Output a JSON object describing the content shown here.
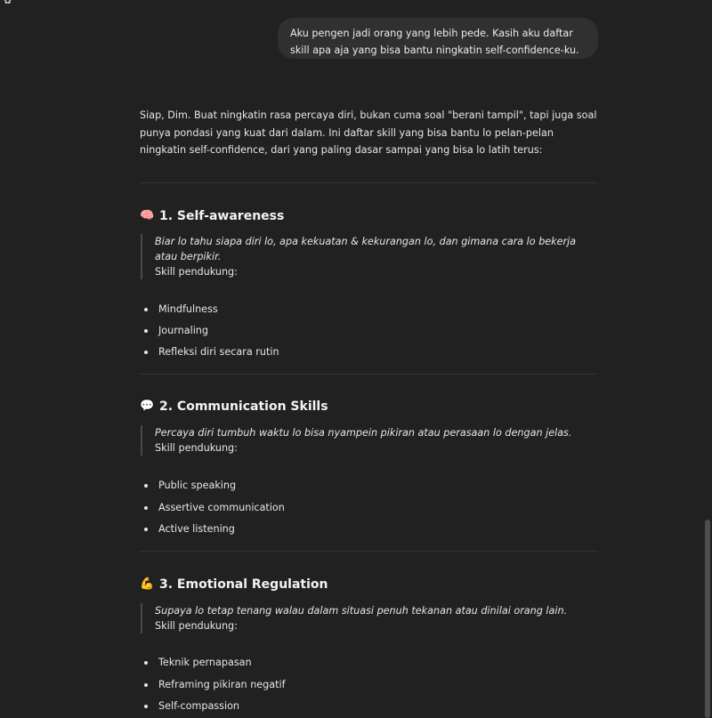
{
  "corner_icon": "openai-logo-icon",
  "user_message": "Aku pengen jadi orang yang lebih pede. Kasih aku daftar skill apa aja yang bisa bantu ningkatin self-confidence-ku.",
  "assistant": {
    "intro": "Siap, Dim. Buat ningkatin rasa percaya diri, bukan cuma soal \"berani tampil\", tapi juga soal punya pondasi yang kuat dari dalam. Ini daftar skill yang bisa bantu lo pelan-pelan ningkatin self-confidence, dari yang paling dasar sampai yang bisa lo latih terus:",
    "sections": [
      {
        "emoji": "🧠",
        "emoji_name": "brain-icon",
        "title": "1. Self-awareness",
        "desc": "Biar lo tahu siapa diri lo, apa kekuatan & kekurangan lo, dan gimana cara lo bekerja atau berpikir.",
        "support_label": "Skill pendukung:",
        "items": [
          "Mindfulness",
          "Journaling",
          "Refleksi diri secara rutin"
        ]
      },
      {
        "emoji": "💬",
        "emoji_name": "speech-bubble-icon",
        "title": "2. Communication Skills",
        "desc": "Percaya diri tumbuh waktu lo bisa nyampein pikiran atau perasaan lo dengan jelas.",
        "support_label": "Skill pendukung:",
        "items": [
          "Public speaking",
          "Assertive communication",
          "Active listening"
        ]
      },
      {
        "emoji": "💪",
        "emoji_name": "flexed-biceps-icon",
        "title": "3. Emotional Regulation",
        "desc": "Supaya lo tetap tenang walau dalam situasi penuh tekanan atau dinilai orang lain.",
        "support_label": "Skill pendukung:",
        "items": [
          "Teknik pernapasan",
          "Reframing pikiran negatif",
          "Self-compassion"
        ]
      }
    ]
  }
}
